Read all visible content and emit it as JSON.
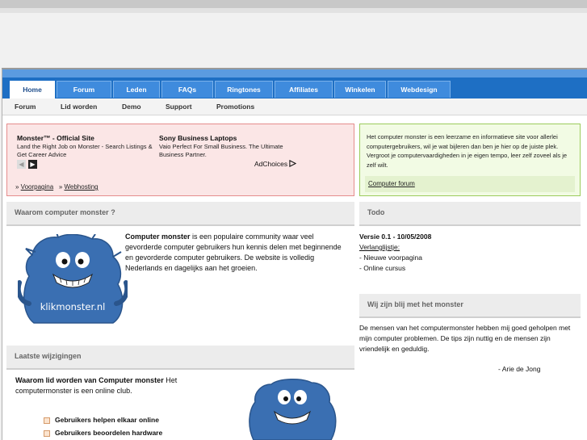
{
  "nav": {
    "tabs": [
      {
        "label": "Home",
        "active": true
      },
      {
        "label": "Forum"
      },
      {
        "label": "Leden"
      },
      {
        "label": "FAQs"
      },
      {
        "label": "Ringtones"
      },
      {
        "label": "Affiliates"
      },
      {
        "label": "Winkelen"
      },
      {
        "label": "Webdesign"
      }
    ],
    "subnav": [
      "Forum",
      "Lid worden",
      "Demo",
      "Support",
      "Promotions"
    ]
  },
  "ads": {
    "ad1": {
      "title": "Monster™ - Official Site",
      "text": "Land the Right Job on Monster - Search Listings & Get Career Advice"
    },
    "ad2": {
      "title": "Sony Business Laptops",
      "text": "Vaio Perfect For Small Business. The Ultimate Business Partner."
    },
    "adchoices": "AdChoices",
    "crumb1": "Voorpagina",
    "crumb2": "Webhosting"
  },
  "intro": {
    "text": "Het computer monster is een leerzame en informatieve site voor allerlei computergebruikers, wil je wat bijleren dan ben je hier op de juiste plek. Vergroot je computervaardigheden in je eigen tempo, leer zelf zoveel als je zelf wilt.",
    "link": "Computer forum"
  },
  "waarom": {
    "heading": "Waarom computer monster ?",
    "bold": "Computer monster",
    "text": " is een populaire community waar veel gevorderde computer gebruikers hun kennis delen met beginnende en gevorderde computer gebruikers. De website is volledig Nederlands en dagelijks aan het groeien.",
    "logo_text": "klikmonster.nl"
  },
  "todo": {
    "heading": "Todo",
    "version": "Versie 0.1 - 10/05/2008",
    "wishlist": "Verlanglijstje:",
    "items": [
      "- Nieuwe voorpagina",
      "- Online cursus"
    ]
  },
  "blij": {
    "heading": "Wij zijn blij met het monster",
    "text": "De mensen van het computermonster hebben mij goed geholpen met mijn computer problemen. De tips zijn nuttig en de mensen zijn vriendelijk en geduldig.",
    "author": "- Arie de Jong"
  },
  "laatste": {
    "heading": "Laatste wijzigingen",
    "bold": "Waarom lid worden van Computer monster",
    "text": " Het computermonster is een online club.",
    "items": [
      "Gebruikers helpen elkaar online",
      "Gebruikers beoordelen hardware"
    ]
  },
  "colors": {
    "nav": "#1e6fc4",
    "monster": "#3a6fb2",
    "ad_bg": "#fbe6e6",
    "green_bg": "#f2fbe4"
  }
}
